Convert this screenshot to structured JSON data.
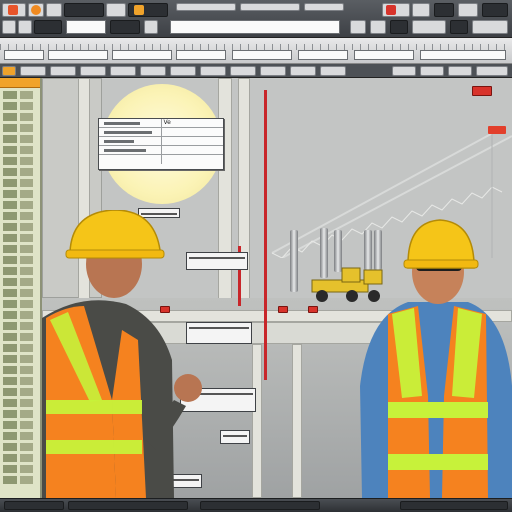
{
  "app": {
    "title": "",
    "accent_color": "#f0a32b",
    "panel_color": "#dfe4c7"
  },
  "toolbar": {
    "field_1": "",
    "field_2": "",
    "zoom_field": ""
  },
  "dialog": {
    "cell_ve": "Ve"
  },
  "workers": [
    {
      "role": "worker-left",
      "helmet_color": "#f5c518",
      "vest_color": "#f5821f"
    },
    {
      "role": "worker-right",
      "helmet_color": "#f5c518",
      "vest_color": "#f5821f"
    }
  ],
  "icons": [
    "app-logo-icon",
    "gear-icon",
    "file-icon",
    "camera-icon",
    "grid-icon",
    "settings-icon",
    "crane-icon"
  ]
}
